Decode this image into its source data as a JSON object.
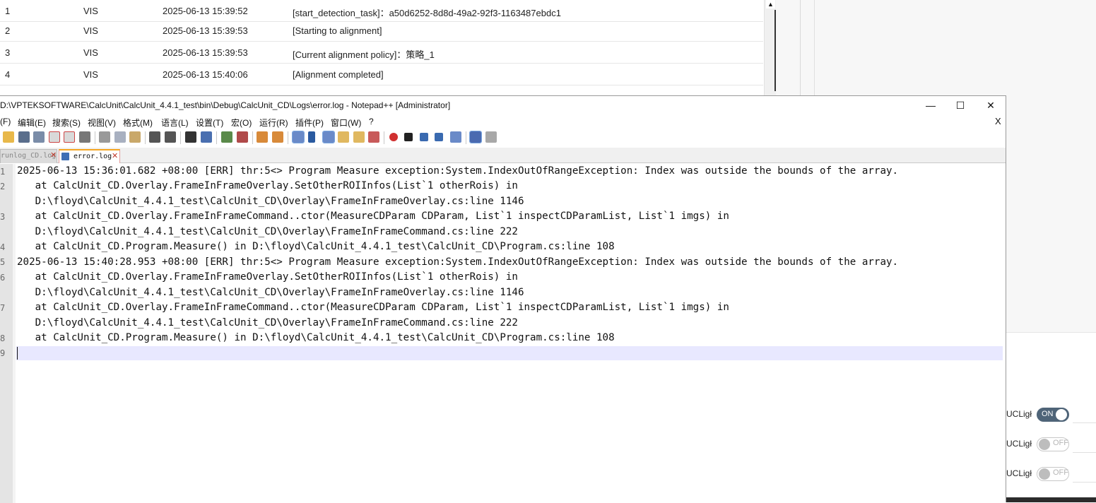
{
  "background_table": {
    "rows": [
      {
        "id": "1",
        "source": "VIS",
        "time": "2025-06-13 15:39:52",
        "message": "[start_detection_task]：a50d6252-8d8d-49a2-92f3-1163487ebdc1"
      },
      {
        "id": "2",
        "source": "VIS",
        "time": "2025-06-13 15:39:53",
        "message": "[Starting to alignment]"
      },
      {
        "id": "3",
        "source": "VIS",
        "time": "2025-06-13 15:39:53",
        "message": "[Current alignment policy]：策略_1"
      },
      {
        "id": "4",
        "source": "VIS",
        "time": "2025-06-13 15:40:06",
        "message": "[Alignment completed]"
      }
    ],
    "scroll_up_glyph": "▲"
  },
  "background_panel": {
    "toggles": [
      {
        "label": "UCLigł",
        "state": "ON"
      },
      {
        "label": "UCLigł",
        "state": "OFF"
      },
      {
        "label": "UCLigł",
        "state": "OFF"
      }
    ]
  },
  "window": {
    "title": "D:\\VPTEKSOFTWARE\\CalcUnit\\CalcUnit_4.4.1_test\\bin\\Debug\\CalcUnit_CD\\Logs\\error.log - Notepad++ [Administrator]",
    "minimize_glyph": "—",
    "maximize_glyph": "☐",
    "close_glyph": "✕"
  },
  "menu": {
    "items": [
      "(F)",
      "编辑(E)",
      "搜索(S)",
      "视图(V)",
      "格式(M)",
      "语言(L)",
      "设置(T)",
      "宏(O)",
      "运行(R)",
      "插件(P)",
      "窗口(W)",
      "?"
    ],
    "close_label": "X"
  },
  "tabs": [
    {
      "label": "runlog_CD.log",
      "close": "✕",
      "active": false
    },
    {
      "label": "error.log",
      "close": "✕",
      "active": true
    }
  ],
  "editor": {
    "lines": [
      {
        "num": "1",
        "text": "2025-06-13 15:36:01.682 +08:00 [ERR] thr:5<> Program Measure exception:System.IndexOutOfRangeException: Index was outside the bounds of the array."
      },
      {
        "num": "2",
        "text": "   at CalcUnit_CD.Overlay.FrameInFrameOverlay.SetOtherROIInfos(List`1 otherRois) in"
      },
      {
        "num": "",
        "text": "   D:\\floyd\\CalcUnit_4.4.1_test\\CalcUnit_CD\\Overlay\\FrameInFrameOverlay.cs:line 1146"
      },
      {
        "num": "3",
        "text": "   at CalcUnit_CD.Overlay.FrameInFrameCommand..ctor(MeasureCDParam CDParam, List`1 inspectCDParamList, List`1 imgs) in"
      },
      {
        "num": "",
        "text": "   D:\\floyd\\CalcUnit_4.4.1_test\\CalcUnit_CD\\Overlay\\FrameInFrameCommand.cs:line 222"
      },
      {
        "num": "4",
        "text": "   at CalcUnit_CD.Program.Measure() in D:\\floyd\\CalcUnit_4.4.1_test\\CalcUnit_CD\\Program.cs:line 108"
      },
      {
        "num": "5",
        "text": "2025-06-13 15:40:28.953 +08:00 [ERR] thr:5<> Program Measure exception:System.IndexOutOfRangeException: Index was outside the bounds of the array."
      },
      {
        "num": "6",
        "text": "   at CalcUnit_CD.Overlay.FrameInFrameOverlay.SetOtherROIInfos(List`1 otherRois) in"
      },
      {
        "num": "",
        "text": "   D:\\floyd\\CalcUnit_4.4.1_test\\CalcUnit_CD\\Overlay\\FrameInFrameOverlay.cs:line 1146"
      },
      {
        "num": "7",
        "text": "   at CalcUnit_CD.Overlay.FrameInFrameCommand..ctor(MeasureCDParam CDParam, List`1 inspectCDParamList, List`1 imgs) in"
      },
      {
        "num": "",
        "text": "   D:\\floyd\\CalcUnit_4.4.1_test\\CalcUnit_CD\\Overlay\\FrameInFrameCommand.cs:line 222"
      },
      {
        "num": "8",
        "text": "   at CalcUnit_CD.Program.Measure() in D:\\floyd\\CalcUnit_4.4.1_test\\CalcUnit_CD\\Program.cs:line 108"
      },
      {
        "num": "9",
        "text": ""
      }
    ]
  },
  "colors": {
    "current_line": "#e8e8ff",
    "toggle_on": "#4f6478",
    "tab_accent": "#f5a623"
  }
}
